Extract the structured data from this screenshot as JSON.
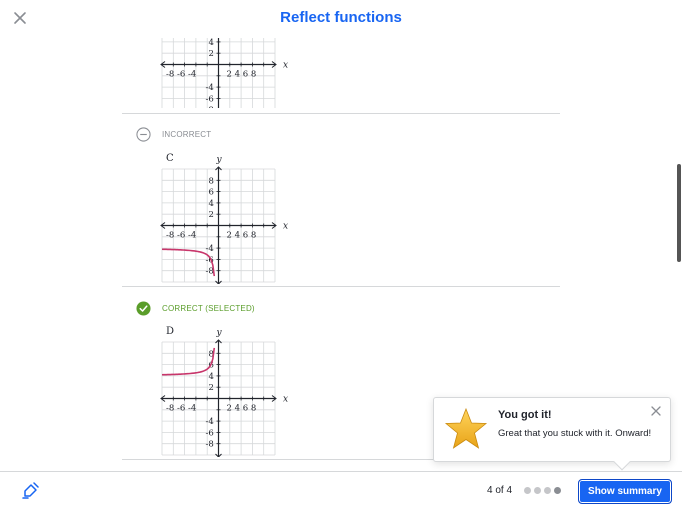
{
  "header": {
    "title": "Reflect functions",
    "close_icon": "close-icon"
  },
  "choices": [
    {
      "letter": "",
      "status": "",
      "curve": "none"
    },
    {
      "letter": "C",
      "status": "INCORRECT",
      "curve": "lower-left"
    },
    {
      "letter": "D",
      "status": "CORRECT (SELECTED)",
      "curve": "upper-left"
    }
  ],
  "graph_labels": {
    "x_axis": "x",
    "y_axis": "y",
    "x_ticks_neg": "-8 -6 -4",
    "x_ticks_pos": "2 4 6 8",
    "y_ticks_pos": [
      "8",
      "6",
      "4",
      "2"
    ],
    "y_ticks_neg": [
      "-4",
      "-6",
      "-8"
    ]
  },
  "toast": {
    "title": "You got it!",
    "message": "Great that you stuck with it. Onward!",
    "icon": "star-icon",
    "close_icon": "close-icon"
  },
  "footer": {
    "tool_icon": "scratchpad-icon",
    "progress": "4 of 4",
    "dots_total": 4,
    "summary_label": "Show summary"
  },
  "colors": {
    "accent": "#1865f2",
    "correct": "#5a9d2a",
    "curve": "#c8366b",
    "grid": "#d6d8da"
  }
}
